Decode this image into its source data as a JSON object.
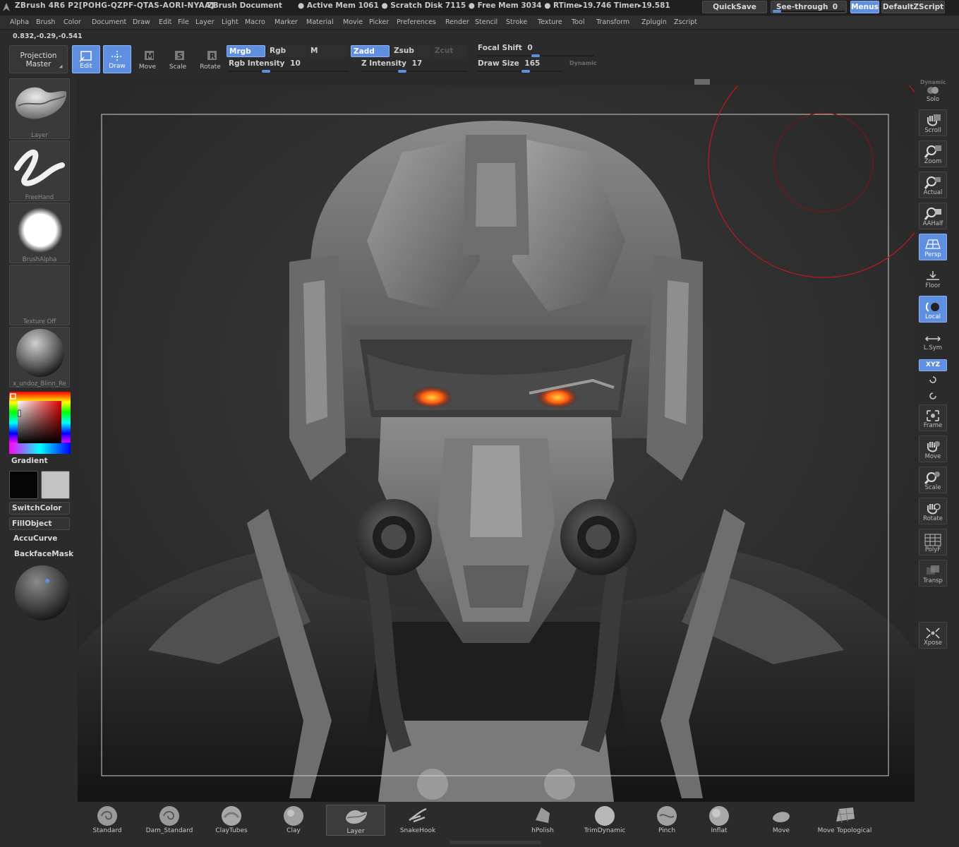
{
  "titlebar": {
    "app_title": "ZBrush 4R6 P2[POHG-QZPF-QTAS-AORI-NYAA]",
    "document": "ZBrush Document",
    "stats": "● Active Mem 1061 ● Scratch Disk 7115 ● Free Mem 3034 ● RTime▸19.746 Timer▸19.581",
    "quicksave": "QuickSave",
    "seethrough_label": "See-through",
    "seethrough_value": "0",
    "seethrough_level": 0.0,
    "menus": "Menus",
    "default_zscript": "DefaultZScript"
  },
  "menubar": [
    "Alpha",
    "Brush",
    "Color",
    "Document",
    "Draw",
    "Edit",
    "File",
    "Layer",
    "Light",
    "Macro",
    "Marker",
    "Material",
    "Movie",
    "Picker",
    "Preferences",
    "Render",
    "Stencil",
    "Stroke",
    "Texture",
    "Tool",
    "Transform",
    "Zplugin",
    "Zscript"
  ],
  "coords": "0.832,-0.29,-0.541",
  "shelf": {
    "projection_master": "Projection Master",
    "tools": [
      "Edit",
      "Draw",
      "Move",
      "Scale",
      "Rotate"
    ],
    "mrgb": "Mrgb",
    "rgb": "Rgb",
    "m": "M",
    "zadd": "Zadd",
    "zsub": "Zsub",
    "zcut": "Zcut",
    "rgb_intensity_label": "Rgb Intensity",
    "rgb_intensity": "10",
    "z_intensity_label": "Z Intensity",
    "z_intensity": "17",
    "focal_shift_label": "Focal Shift",
    "focal_shift": "0",
    "draw_size_label": "Draw Size",
    "draw_size": "165",
    "dynamic": "Dynamic"
  },
  "left": {
    "layer": "Layer",
    "freehand": "FreeHand",
    "brushalpha": "BrushAlpha",
    "texture": "Texture Off",
    "material": "x_undoz_Blinn_Re",
    "gradient": "Gradient",
    "switchcolor": "SwitchColor",
    "fillobject": "FillObject",
    "accucurve": "AccuCurve",
    "backfacemask": "BackfaceMask",
    "main_color": "#050505",
    "secondary_color": "#c2c2c2"
  },
  "right": {
    "dynamic": "Dynamic",
    "solo": "Solo",
    "scroll": "Scroll",
    "zoom": "Zoom",
    "actual": "Actual",
    "aahalf": "AAHalf",
    "persp": "Persp",
    "floor": "Floor",
    "local": "Local",
    "lsym": "L.Sym",
    "xyz": "XYZ",
    "frame": "Frame",
    "move": "Move",
    "scale": "Scale",
    "rotate": "Rotate",
    "polyf": "PolyF",
    "transp": "Transp",
    "xpose": "Xpose"
  },
  "bottom": [
    "Standard",
    "Dam_Standard",
    "ClayTubes",
    "Clay",
    "Layer",
    "SnakeHook",
    "hPolish",
    "TrimDynamic",
    "Pinch",
    "Inflat",
    "Move",
    "Move Topological"
  ],
  "colors": {
    "accent": "#5e8fe0",
    "cursor_ring": "#c0181c",
    "eye_glow": "#ff5a10"
  }
}
